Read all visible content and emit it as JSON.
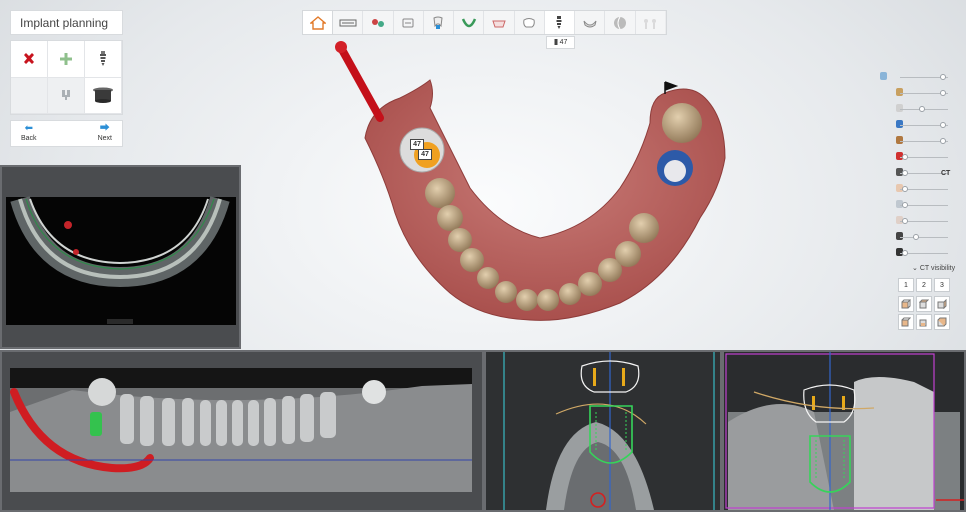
{
  "app": {
    "title": "Implant planning"
  },
  "nav": {
    "back_label": "Back",
    "next_label": "Next"
  },
  "tools": [
    {
      "icon": "delete-icon",
      "enabled": true
    },
    {
      "icon": "add-implant-icon",
      "enabled": true
    },
    {
      "icon": "implant-icon",
      "enabled": true
    },
    {
      "icon": "empty-icon",
      "enabled": false
    },
    {
      "icon": "abutment-icon",
      "enabled": false
    },
    {
      "icon": "sleeve-icon",
      "enabled": true
    }
  ],
  "workflow": {
    "steps": [
      {
        "icon": "scan-icon",
        "active": false
      },
      {
        "icon": "segmentation-icon",
        "active": false
      },
      {
        "icon": "model-icon",
        "active": false
      },
      {
        "icon": "tooth-select-icon",
        "active": false
      },
      {
        "icon": "arch-icon",
        "active": false
      },
      {
        "icon": "crown-icon",
        "active": false
      },
      {
        "icon": "tooth-icon",
        "active": false
      },
      {
        "icon": "implant-step-icon",
        "active": true
      },
      {
        "icon": "guide-icon",
        "active": false
      },
      {
        "icon": "sphere-icon",
        "active": false
      },
      {
        "icon": "export-icon",
        "active": false
      }
    ],
    "active_tooltip": "47"
  },
  "viewport": {
    "implant_tooth_label": "47",
    "implant_label_2": "47"
  },
  "view_controls": {
    "sliders": [
      {
        "icon": "implant-visibility-icon",
        "level": 0.95
      },
      {
        "icon": "jaw-model-icon",
        "level": 0.95
      },
      {
        "icon": "tooth-model-icon",
        "level": 0.45
      },
      {
        "icon": "sleeve-visibility-icon",
        "level": 0.95
      },
      {
        "icon": "guide-visibility-icon",
        "level": 0.95
      },
      {
        "icon": "nerve-icon",
        "level": 0.05
      },
      {
        "icon": "ct-icon",
        "level": 0.05
      },
      {
        "icon": "crown-visibility-icon",
        "level": 0.05
      },
      {
        "icon": "abutment-visibility-icon",
        "level": 0.05
      },
      {
        "icon": "gingiva-icon",
        "level": 0.05
      },
      {
        "icon": "brightness-icon",
        "level": 0.3
      },
      {
        "icon": "contrast-icon",
        "level": 0.05
      }
    ],
    "ct_label": "CT",
    "ct_visibility_label": "CT visibility",
    "layout_buttons": [
      "1",
      "2",
      "3"
    ],
    "view_cubes": [
      "front-view-icon",
      "left-view-icon",
      "right-view-icon",
      "top-view-icon",
      "bottom-view-icon",
      "back-view-icon"
    ]
  },
  "colors": {
    "accent": "#2c8fd6",
    "implant_green": "#3ddc5a",
    "nerve_red": "#d42020",
    "crown_yellow": "#f0b020",
    "panel_bg": "#4a4c4f"
  }
}
